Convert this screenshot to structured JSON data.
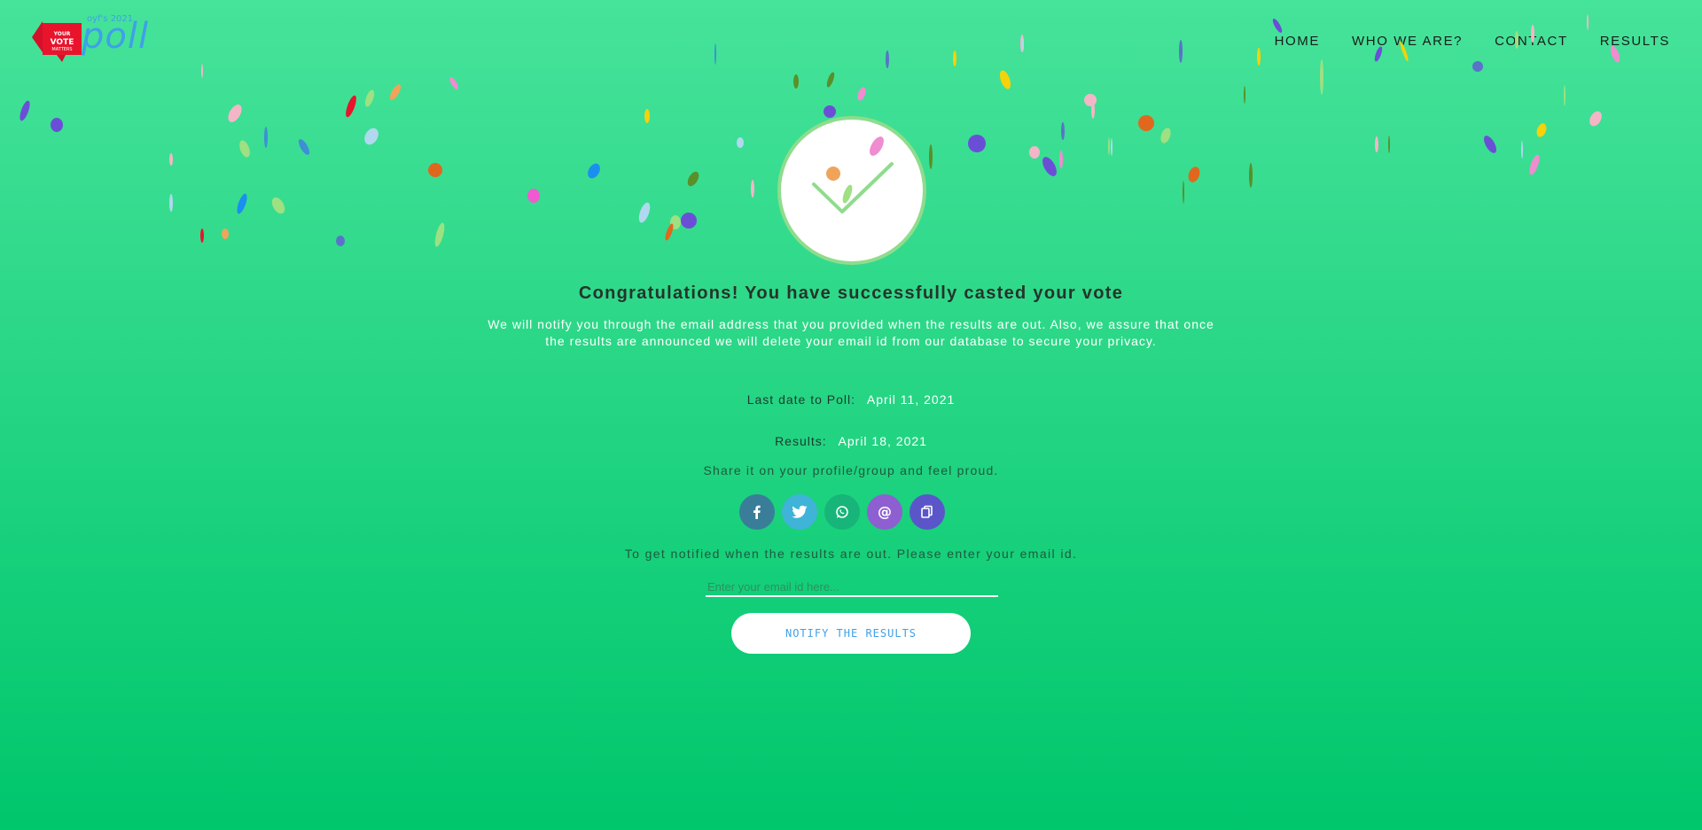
{
  "logo": {
    "year_text": "oyf's 2021",
    "word": "poll",
    "badge_line1": "YOUR",
    "badge_line2": "VOTE",
    "badge_line3": "MATTERS"
  },
  "nav": {
    "items": [
      {
        "label": "HOME"
      },
      {
        "label": "WHO WE ARE?"
      },
      {
        "label": "CONTACT"
      },
      {
        "label": "RESULTS"
      }
    ]
  },
  "main": {
    "title": "Congratulations! You have successfully casted your vote",
    "description": "We will notify you through the email address that you provided when the results are out. Also, we assure that once the results are announced we will delete your email id from our database to secure your privacy.",
    "last_date_label": "Last date to Poll:",
    "last_date_value": "April 11, 2021",
    "results_label": "Results:",
    "results_value": "April 18, 2021",
    "share_text": "Share it on your profile/group and feel proud.",
    "share_buttons": [
      {
        "icon": "facebook-icon",
        "color": "#3a7d99"
      },
      {
        "icon": "twitter-icon",
        "color": "#3fb3d8"
      },
      {
        "icon": "whatsapp-icon",
        "color": "#17b57a"
      },
      {
        "icon": "email-at-icon",
        "color": "#8e5fd0"
      },
      {
        "icon": "copy-link-icon",
        "color": "#5a56c9"
      }
    ],
    "notify_text": "To get notified when the results are out. Please enter your email id.",
    "email_placeholder": "Enter your email id here...",
    "notify_button": "NOTIFY THE RESULTS"
  },
  "colors": {
    "bg_top": "#46e39a",
    "bg_bottom": "#00c66c",
    "check_border": "#8fdc8c",
    "accent_blue": "#3fa0e8"
  }
}
